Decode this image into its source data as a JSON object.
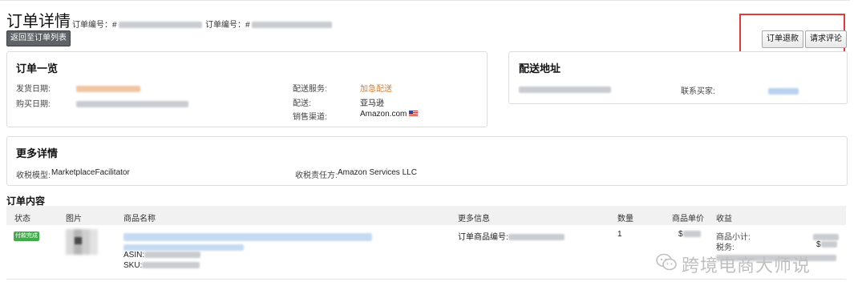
{
  "header": {
    "title": "订单详情",
    "order_no_label_1": "订单编号：#",
    "order_no_label_2": "订单编号：#",
    "back_button": "返回至订单列表",
    "refund_button": "订单退款",
    "review_button": "请求评论"
  },
  "order_overview": {
    "title": "订单一览",
    "ship_date_label": "发货日期:",
    "purchase_date_label": "购买日期:",
    "shipping_service_label": "配送服务:",
    "shipping_service_value": "加急配送",
    "fulfillment_label": "配送:",
    "fulfillment_value": "亚马逊",
    "sales_channel_label": "销售渠道:",
    "sales_channel_value": "Amazon.com"
  },
  "shipping_address": {
    "title": "配送地址",
    "contact_buyer_label": "联系买家:"
  },
  "more_details": {
    "title": "更多详情",
    "tax_model_label": "收税模型:",
    "tax_model_value": "MarketplaceFacilitator",
    "tax_party_label": "收税责任方:",
    "tax_party_value": "Amazon Services LLC"
  },
  "order_contents": {
    "title": "订单内容",
    "columns": [
      "状态",
      "图片",
      "商品名称",
      "更多信息",
      "数量",
      "商品单价",
      "收益"
    ],
    "row": {
      "status": "付款完成",
      "asin_label": "ASIN:",
      "sku_label": "SKU:",
      "item_code_label": "订单商品编号:",
      "quantity": "1",
      "unit_price_prefix": "$",
      "subtotal_label": "商品小计:",
      "tax_label": "税务:",
      "tax_prefix": "$"
    }
  },
  "watermark": {
    "text": "跨境电商大师说",
    "icon": "wechat-icon"
  },
  "colors": {
    "accent_orange": "#e7791d",
    "highlight_red": "#e4383b",
    "status_green": "#3fae49"
  }
}
